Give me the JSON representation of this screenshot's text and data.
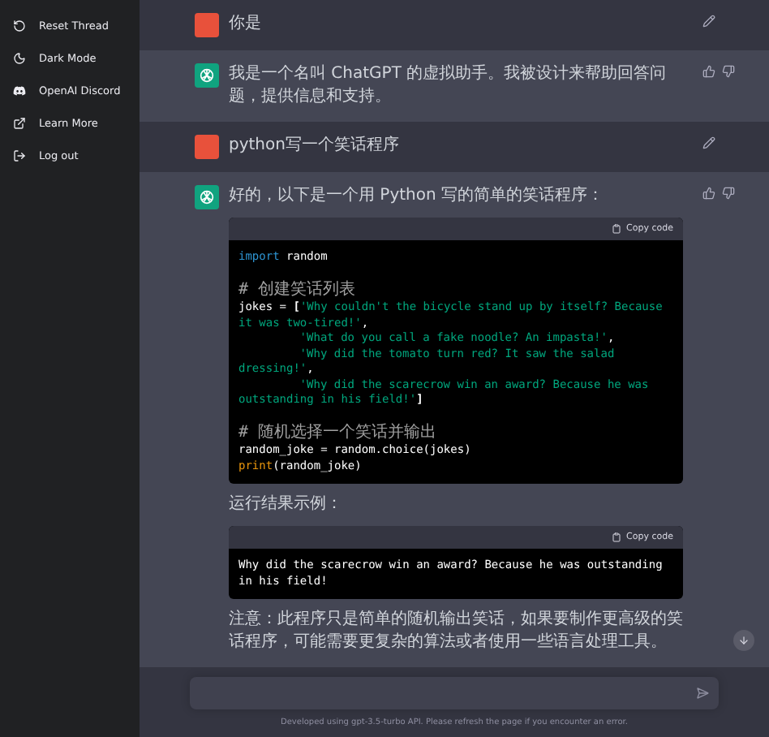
{
  "sidebar": {
    "items": [
      {
        "kind": "reset",
        "label": "Reset Thread"
      },
      {
        "kind": "moon",
        "label": "Dark Mode"
      },
      {
        "kind": "discord",
        "label": "OpenAI Discord"
      },
      {
        "kind": "external",
        "label": "Learn More"
      },
      {
        "kind": "logout",
        "label": "Log out"
      }
    ]
  },
  "messages": [
    {
      "kind": "user",
      "blocks": [
        {
          "kind": "text",
          "text": "你是"
        }
      ]
    },
    {
      "kind": "assistant",
      "blocks": [
        {
          "kind": "text",
          "text": "我是一个名叫 ChatGPT 的虚拟助手。我被设计来帮助回答问题，提供信息和支持。"
        }
      ]
    },
    {
      "kind": "user",
      "blocks": [
        {
          "kind": "text",
          "text": "python写一个笑话程序"
        }
      ]
    },
    {
      "kind": "assistant",
      "blocks": [
        {
          "kind": "text",
          "text": "好的，以下是一个用 Python 写的简单的笑话程序："
        },
        {
          "kind": "code",
          "copy_label": "Copy code",
          "lines": [
            {
              "kind": "code",
              "indent": false,
              "tokens": [
                {
                  "kind": "keyword",
                  "text": "import"
                },
                {
                  "kind": "plain",
                  "text": " random"
                }
              ]
            },
            {
              "kind": "blank"
            },
            {
              "kind": "code",
              "indent": false,
              "tokens": [
                {
                  "kind": "comment",
                  "text": "# 创建笑话列表"
                }
              ]
            },
            {
              "kind": "code",
              "indent": false,
              "tokens": [
                {
                  "kind": "plain",
                  "text": "jokes = "
                },
                {
                  "kind": "bracket",
                  "text": "["
                },
                {
                  "kind": "string",
                  "text": "'Why couldn't the bicycle stand up by itself? Because"
                }
              ]
            },
            {
              "kind": "code",
              "indent": false,
              "tokens": [
                {
                  "kind": "string",
                  "text": "it was two-tired!'"
                },
                {
                  "kind": "plain",
                  "text": ","
                }
              ]
            },
            {
              "kind": "code",
              "indent": true,
              "tokens": [
                {
                  "kind": "string",
                  "text": "'What do you call a fake noodle? An impasta!'"
                },
                {
                  "kind": "plain",
                  "text": ","
                }
              ]
            },
            {
              "kind": "code",
              "indent": true,
              "tokens": [
                {
                  "kind": "string",
                  "text": "'Why did the tomato turn red? It saw the salad"
                }
              ]
            },
            {
              "kind": "code",
              "indent": false,
              "tokens": [
                {
                  "kind": "string",
                  "text": "dressing!'"
                },
                {
                  "kind": "plain",
                  "text": ","
                }
              ]
            },
            {
              "kind": "code",
              "indent": true,
              "tokens": [
                {
                  "kind": "string",
                  "text": "'Why did the scarecrow win an award? Because he was"
                }
              ]
            },
            {
              "kind": "code",
              "indent": false,
              "tokens": [
                {
                  "kind": "string",
                  "text": "outstanding in his field!'"
                },
                {
                  "kind": "bracket",
                  "text": "]"
                }
              ]
            },
            {
              "kind": "blank"
            },
            {
              "kind": "code",
              "indent": false,
              "tokens": [
                {
                  "kind": "comment",
                  "text": "# 随机选择一个笑话并输出"
                }
              ]
            },
            {
              "kind": "code",
              "indent": false,
              "tokens": [
                {
                  "kind": "plain",
                  "text": "random_joke = random.choice(jokes)"
                }
              ]
            },
            {
              "kind": "code",
              "indent": false,
              "tokens": [
                {
                  "kind": "builtin",
                  "text": "print"
                },
                {
                  "kind": "plain",
                  "text": "(random_joke)"
                }
              ]
            }
          ]
        },
        {
          "kind": "text",
          "text": "运行结果示例："
        },
        {
          "kind": "code",
          "copy_label": "Copy code",
          "lines": [
            {
              "kind": "code",
              "indent": false,
              "tokens": [
                {
                  "kind": "plain",
                  "text": "Why did the scarecrow win an award? Because he was outstanding"
                }
              ]
            },
            {
              "kind": "code",
              "indent": false,
              "tokens": [
                {
                  "kind": "plain",
                  "text": "in his field!"
                }
              ]
            }
          ]
        },
        {
          "kind": "text",
          "text": "注意：此程序只是简单的随机输出笑话，如果要制作更高级的笑话程序，可能需要更复杂的算法或者使用一些语言处理工具。"
        }
      ]
    }
  ],
  "footer": "Developed using gpt-3.5-turbo API. Please refresh the page if you encounter an error."
}
